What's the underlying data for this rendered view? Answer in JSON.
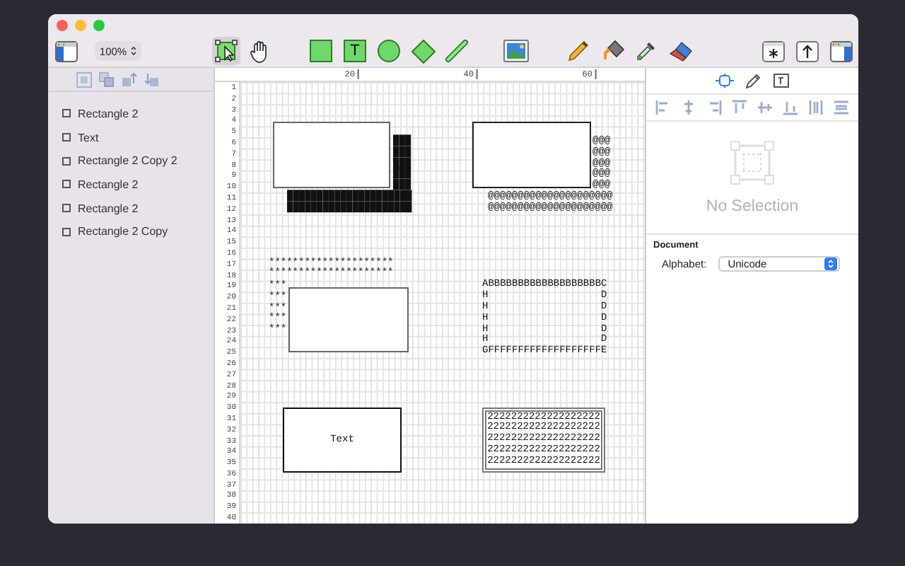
{
  "toolbar": {
    "zoom": "100%",
    "tools": [
      {
        "kind": "select",
        "selected": true
      },
      {
        "kind": "hand",
        "selected": false
      },
      {
        "kind": "rectangle",
        "selected": false
      },
      {
        "kind": "text",
        "label": "T",
        "selected": false
      },
      {
        "kind": "oval",
        "selected": false
      },
      {
        "kind": "diamond",
        "selected": false
      },
      {
        "kind": "line",
        "selected": false
      },
      {
        "kind": "image",
        "selected": false
      },
      {
        "kind": "pencil",
        "selected": false
      },
      {
        "kind": "fill",
        "selected": false
      },
      {
        "kind": "eyedropper",
        "selected": false
      },
      {
        "kind": "eraser",
        "selected": false
      }
    ]
  },
  "layers": [
    {
      "label": "Rectangle 2"
    },
    {
      "label": "Text"
    },
    {
      "label": "Rectangle 2 Copy 2"
    },
    {
      "label": "Rectangle 2"
    },
    {
      "label": "Rectangle 2"
    },
    {
      "label": "Rectangle 2 Copy"
    }
  ],
  "ruler": {
    "marks": [
      "20",
      "40",
      "60"
    ]
  },
  "line_numbers": [
    "1",
    "2",
    "3",
    "4",
    "5",
    "6",
    "7",
    "8",
    "9",
    "10",
    "11",
    "12",
    "13",
    "14",
    "15",
    "16",
    "17",
    "18",
    "19",
    "20",
    "21",
    "22",
    "23",
    "24",
    "25",
    "26",
    "27",
    "28",
    "29",
    "30",
    "31",
    "32",
    "33",
    "34",
    "35",
    "36",
    "37",
    "38",
    "39",
    "40"
  ],
  "canvas": {
    "items": [
      {
        "kind": "box"
      },
      {
        "kind": "art",
        "lines": [
          "███",
          "███",
          "███",
          "███",
          "███"
        ]
      },
      {
        "kind": "art",
        "lines": [
          "█████████████████████",
          "█████████████████████"
        ]
      },
      {
        "kind": "box"
      },
      {
        "kind": "art",
        "lines": [
          "@@@",
          "@@@",
          "@@@",
          "@@@",
          "@@@"
        ]
      },
      {
        "kind": "art",
        "lines": [
          "@@@@@@@@@@@@@@@@@@@@@",
          "@@@@@@@@@@@@@@@@@@@@@"
        ]
      },
      {
        "kind": "art",
        "lines": [
          "*********************",
          "*********************"
        ]
      },
      {
        "kind": "art",
        "lines": [
          "***",
          "***",
          "***",
          "***",
          "***"
        ]
      },
      {
        "kind": "box"
      },
      {
        "kind": "art",
        "lines": [
          "ABBBBBBBBBBBBBBBBBBBC",
          "H                   D",
          "H                   D",
          "H                   D",
          "H                   D",
          "H                   D",
          "GFFFFFFFFFFFFFFFFFFFE"
        ]
      },
      {
        "kind": "label-box",
        "label": "Text"
      },
      {
        "kind": "framed-art",
        "lines": [
          "2222222222222222222",
          "2222222222222222222",
          "2222222222222222222",
          "2222222222222222222",
          "2222222222222222222"
        ]
      }
    ]
  },
  "inspector": {
    "tabs": [
      {
        "kind": "style",
        "selected": true
      },
      {
        "kind": "pencil",
        "selected": false
      },
      {
        "kind": "text",
        "selected": false
      }
    ],
    "empty_state": "No Selection",
    "document": {
      "heading": "Document",
      "alphabet_label": "Alphabet:",
      "alphabet_value": "Unicode"
    }
  }
}
